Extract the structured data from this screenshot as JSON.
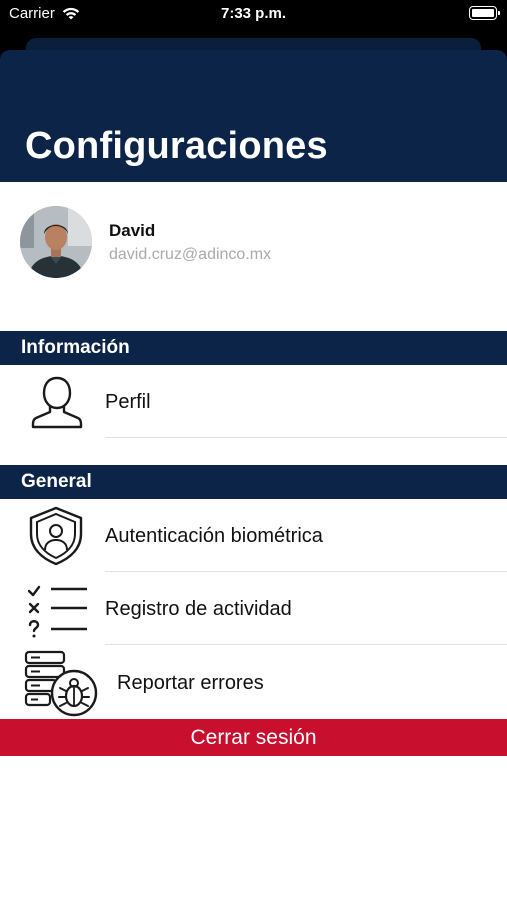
{
  "status_bar": {
    "carrier": "Carrier",
    "time": "7:33 p.m.",
    "battery_icon": "battery-full-icon",
    "wifi_icon": "wifi-icon"
  },
  "header": {
    "title": "Configuraciones",
    "background_color": "#0b2447"
  },
  "profile": {
    "name": "David",
    "email": "david.cruz@adinco.mx",
    "avatar_icon": "user-avatar-photo"
  },
  "sections": [
    {
      "title": "Información",
      "items": [
        {
          "label": "Perfil",
          "icon": "person-outline-icon"
        }
      ]
    },
    {
      "title": "General",
      "items": [
        {
          "label": "Autenticación biométrica",
          "icon": "shield-user-icon"
        },
        {
          "label": "Registro de actividad",
          "icon": "activity-checklist-icon"
        },
        {
          "label": "Reportar errores",
          "icon": "server-bug-icon"
        }
      ]
    }
  ],
  "logout": {
    "label": "Cerrar sesión",
    "color": "#c8102e"
  }
}
